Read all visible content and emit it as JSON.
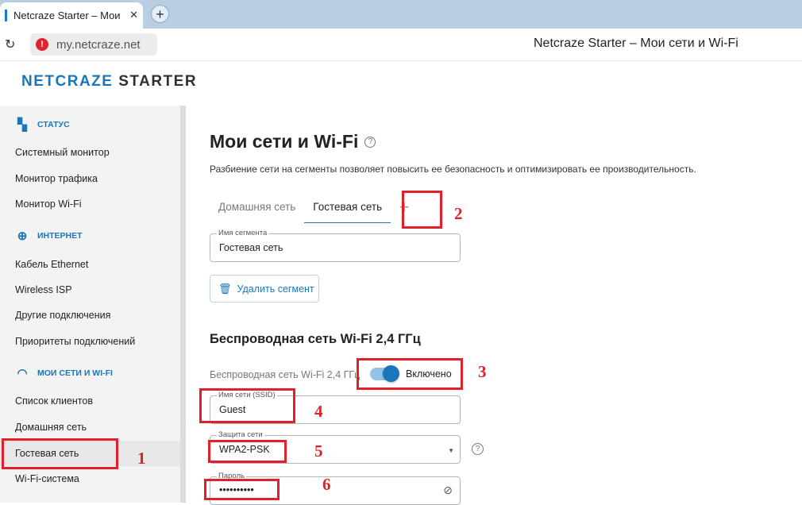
{
  "browser": {
    "tab_title": "Netcraze Starter – Мои",
    "tab_close": "✕",
    "new_tab": "+",
    "url": "my.netcraze.net",
    "window_title": "Netcraze Starter – Мои сети и Wi-Fi"
  },
  "header": {
    "logo_part1": "NETCRAZE",
    "logo_part2": "STARTER"
  },
  "sidebar": {
    "sections": [
      {
        "title": "СТАТУС",
        "icon": "dashboard-icon"
      },
      {
        "title": "ИНТЕРНЕТ",
        "icon": "globe-icon"
      },
      {
        "title": "МОИ СЕТИ И WI-FI",
        "icon": "wifi-icon"
      }
    ],
    "status_items": [
      "Системный монитор",
      "Монитор трафика",
      "Монитор Wi-Fi"
    ],
    "internet_items": [
      "Кабель Ethernet",
      "Wireless ISP",
      "Другие подключения",
      "Приоритеты подключений"
    ],
    "network_items": [
      "Список клиентов",
      "Домашняя сеть",
      "Гостевая сеть",
      "Wi-Fi-система"
    ],
    "active_item": "Гостевая сеть"
  },
  "main": {
    "title": "Мои сети и Wi-Fi",
    "help": "?",
    "description": "Разбиение сети на сегменты позволяет повысить ее безопасность и оптимизировать ее производительность.",
    "tabs": [
      "Домашняя сеть",
      "Гостевая сеть"
    ],
    "active_tab": "Гостевая сеть",
    "add_tab": "+",
    "segment_name_label": "Имя сегмента",
    "segment_name_value": "Гостевая сеть",
    "delete_button": "Удалить сегмент",
    "wifi_section_title": "Беспроводная сеть Wi-Fi 2,4 ГГц",
    "wifi_toggle_label": "Беспроводная сеть Wi-Fi 2,4 ГГц",
    "wifi_toggle_state": "Включено",
    "ssid_label": "Имя сети (SSID)",
    "ssid_value": "Guest",
    "security_label": "Защита сети",
    "security_value": "WPA2-PSK",
    "password_label": "Пароль",
    "password_value": "••••••••••"
  },
  "annotations": [
    "1",
    "2",
    "3",
    "4",
    "5",
    "6"
  ],
  "colors": {
    "accent": "#1a76b8",
    "annotation": "#e0202a",
    "sidebar_bg": "#f3f3f3"
  }
}
